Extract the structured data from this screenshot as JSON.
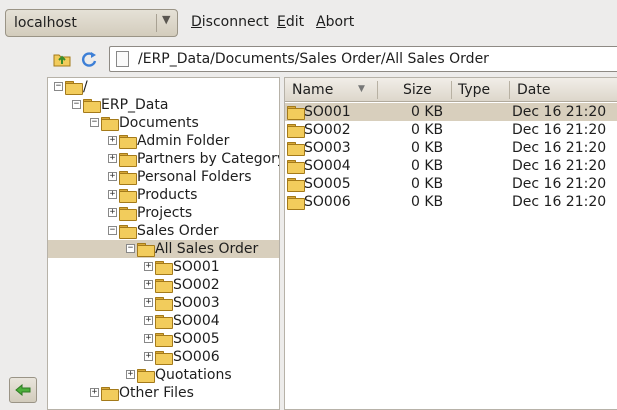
{
  "toolbar": {
    "host": "localhost",
    "menu": [
      {
        "text": "Disconnect"
      },
      {
        "text": "Edit"
      },
      {
        "text": "Abort"
      }
    ],
    "path": "/ERP_Data/Documents/Sales Order/All Sales Order"
  },
  "tree": [
    {
      "label": "/",
      "expander": "−"
    },
    {
      "label": "ERP_Data",
      "expander": "−"
    },
    {
      "label": "Documents",
      "expander": "−"
    },
    {
      "label": "Admin Folder",
      "expander": "+"
    },
    {
      "label": "Partners by Category",
      "expander": "+"
    },
    {
      "label": "Personal Folders",
      "expander": "+"
    },
    {
      "label": "Products",
      "expander": "+"
    },
    {
      "label": "Projects",
      "expander": "+"
    },
    {
      "label": "Sales Order",
      "expander": "−"
    },
    {
      "label": "All Sales Order",
      "expander": "−",
      "selected": true
    },
    {
      "label": "SO001",
      "expander": "+"
    },
    {
      "label": "SO002",
      "expander": "+"
    },
    {
      "label": "SO003",
      "expander": "+"
    },
    {
      "label": "SO004",
      "expander": "+"
    },
    {
      "label": "SO005",
      "expander": "+"
    },
    {
      "label": "SO006",
      "expander": "+"
    },
    {
      "label": "Quotations",
      "expander": "+"
    },
    {
      "label": "Other Files",
      "expander": "+"
    }
  ],
  "list": {
    "columns": [
      "Name",
      "Size",
      "Type",
      "Date"
    ],
    "sort_indicator": "▼",
    "rows": [
      {
        "name": "SO001",
        "size": "0 KB",
        "type": "",
        "date": "Dec 16 21:20",
        "selected": true
      },
      {
        "name": "SO002",
        "size": "0 KB",
        "type": "",
        "date": "Dec 16 21:20"
      },
      {
        "name": "SO003",
        "size": "0 KB",
        "type": "",
        "date": "Dec 16 21:20"
      },
      {
        "name": "SO004",
        "size": "0 KB",
        "type": "",
        "date": "Dec 16 21:20"
      },
      {
        "name": "SO005",
        "size": "0 KB",
        "type": "",
        "date": "Dec 16 21:20"
      },
      {
        "name": "SO006",
        "size": "0 KB",
        "type": "",
        "date": "Dec 16 21:20"
      }
    ]
  },
  "icons": {
    "host_dropdown": "chevron-down-icon",
    "up": "folder-up-icon",
    "refresh": "refresh-icon",
    "path": "document-icon",
    "folder": "folder-icon",
    "back": "back-arrow-icon"
  },
  "colors": {
    "selection": "#d8cfbd",
    "folder": "#f2cc5c",
    "back_arrow": "#4caf3a",
    "refresh": "#3d7fd6"
  }
}
